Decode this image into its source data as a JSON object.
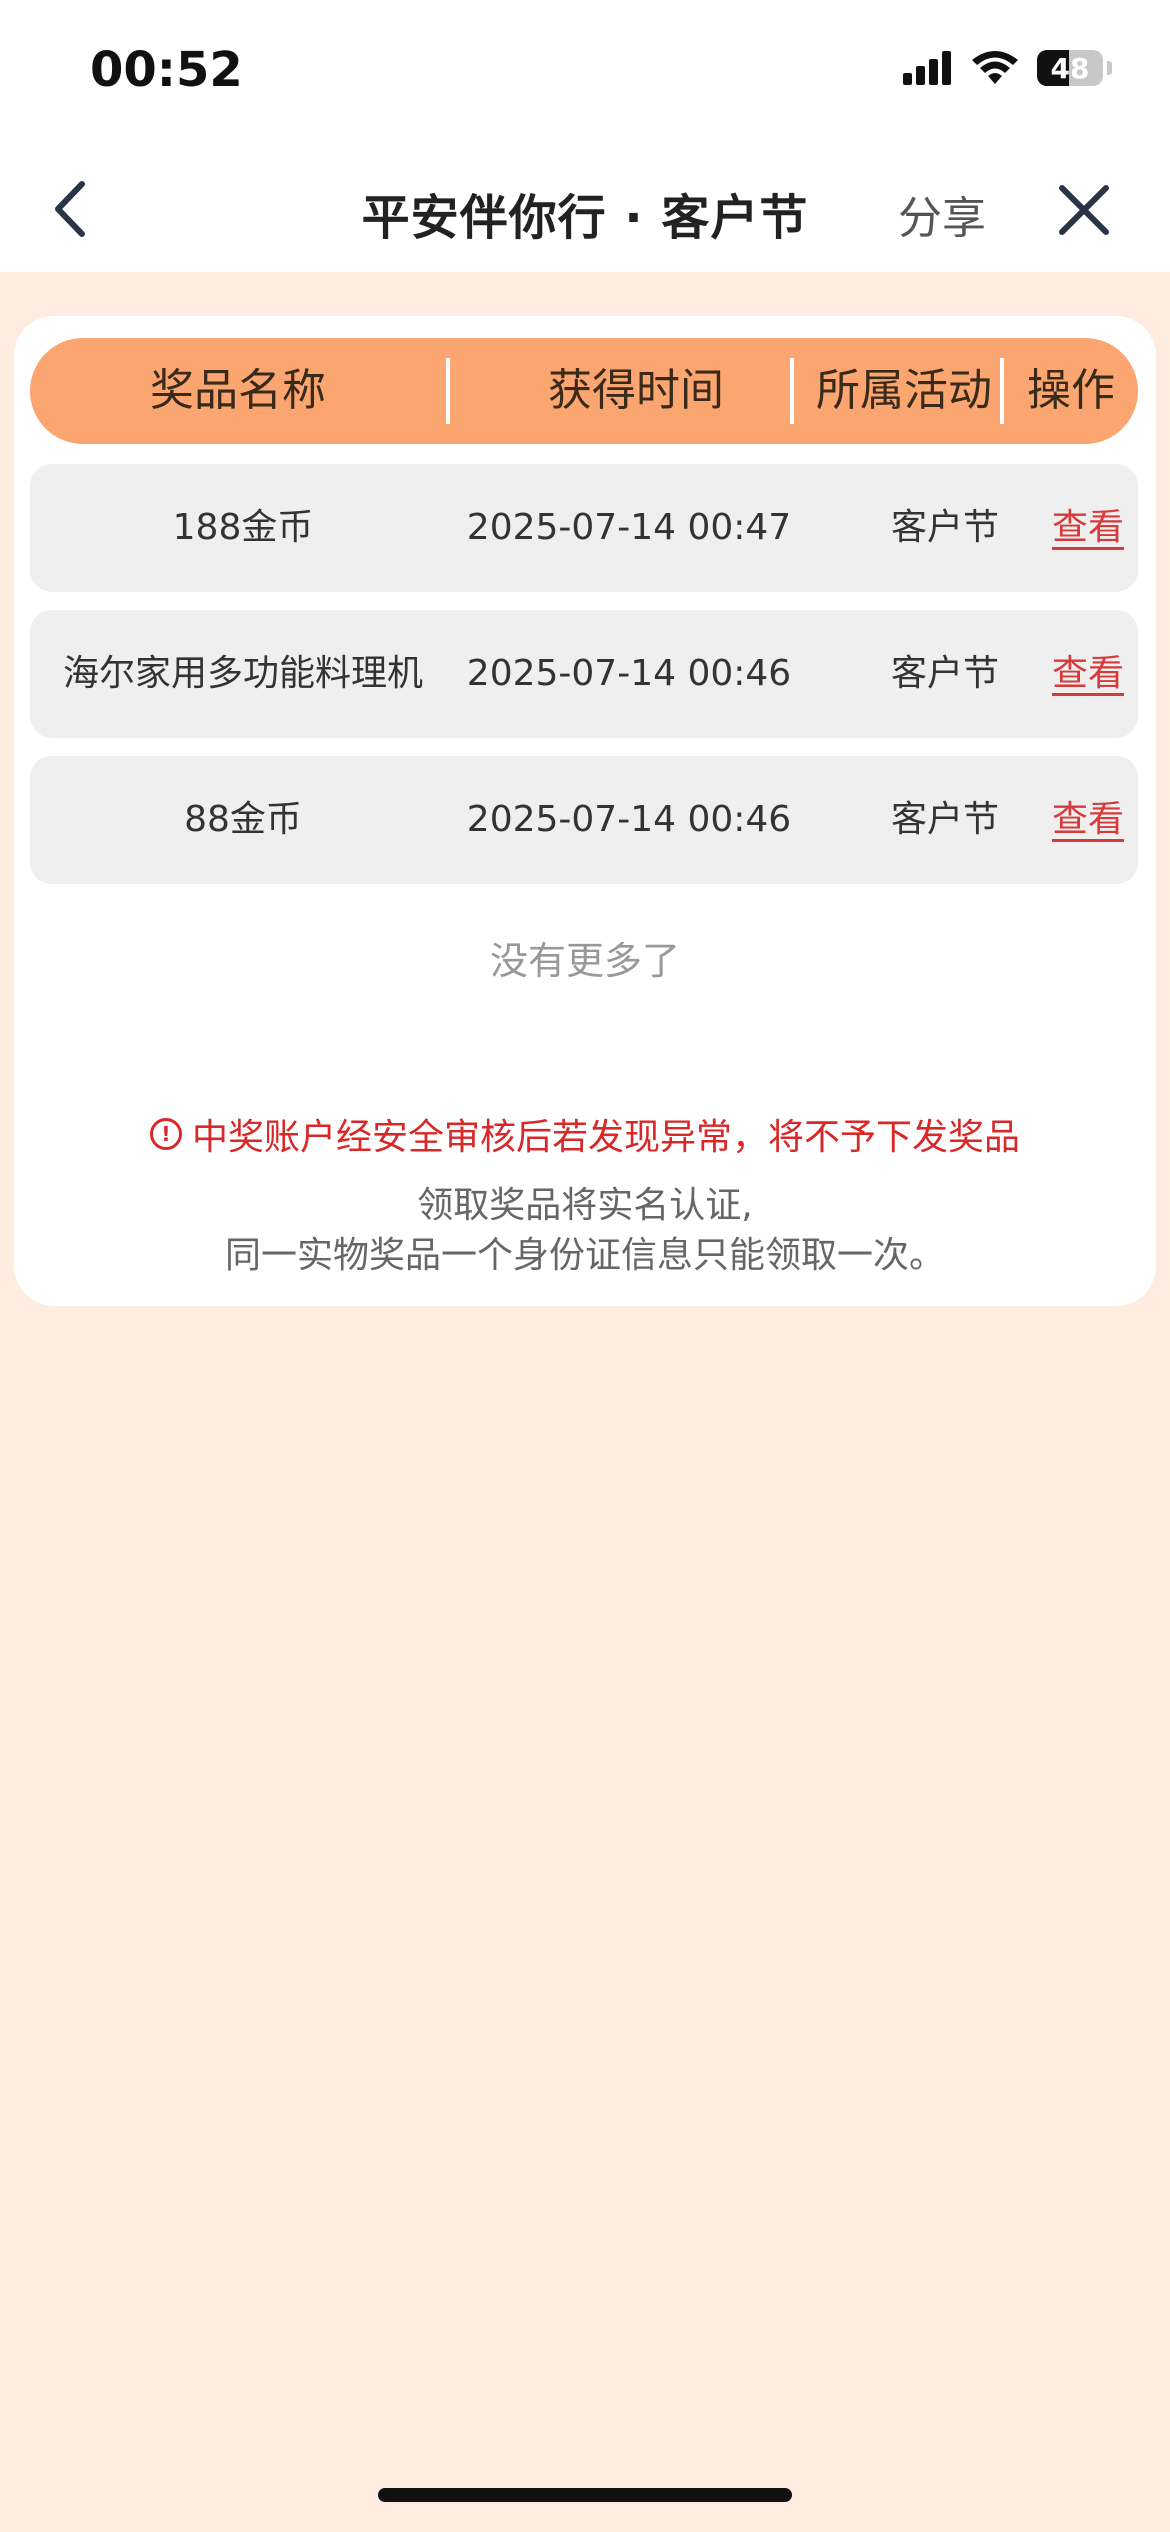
{
  "status_bar": {
    "time": "00:52",
    "battery": "48"
  },
  "nav": {
    "title": "平安伴你行 · 客户节",
    "share": "分享"
  },
  "table": {
    "headers": [
      "奖品名称",
      "获得时间",
      "所属活动",
      "操作"
    ],
    "rows": [
      {
        "name": "188金币",
        "time": "2025-07-14 00:47",
        "activity": "客户节",
        "action": "查看"
      },
      {
        "name": "海尔家用多功能料理机",
        "time": "2025-07-14 00:46",
        "activity": "客户节",
        "action": "查看"
      },
      {
        "name": "88金币",
        "time": "2025-07-14 00:46",
        "activity": "客户节",
        "action": "查看"
      }
    ]
  },
  "no_more": "没有更多了",
  "warning": "中奖账户经安全审核后若发现异常，将不予下发奖品",
  "notes": [
    "领取奖品将实名认证,",
    "同一实物奖品一个身份证信息只能领取一次。"
  ],
  "colors": {
    "header_bg": "#fba570",
    "page_bg": "#fdecdf",
    "warning": "#d92828",
    "link": "#d63a3a"
  },
  "icons": {
    "back": "chevron-left-icon",
    "close": "close-icon",
    "warning": "alert-circle-icon"
  }
}
